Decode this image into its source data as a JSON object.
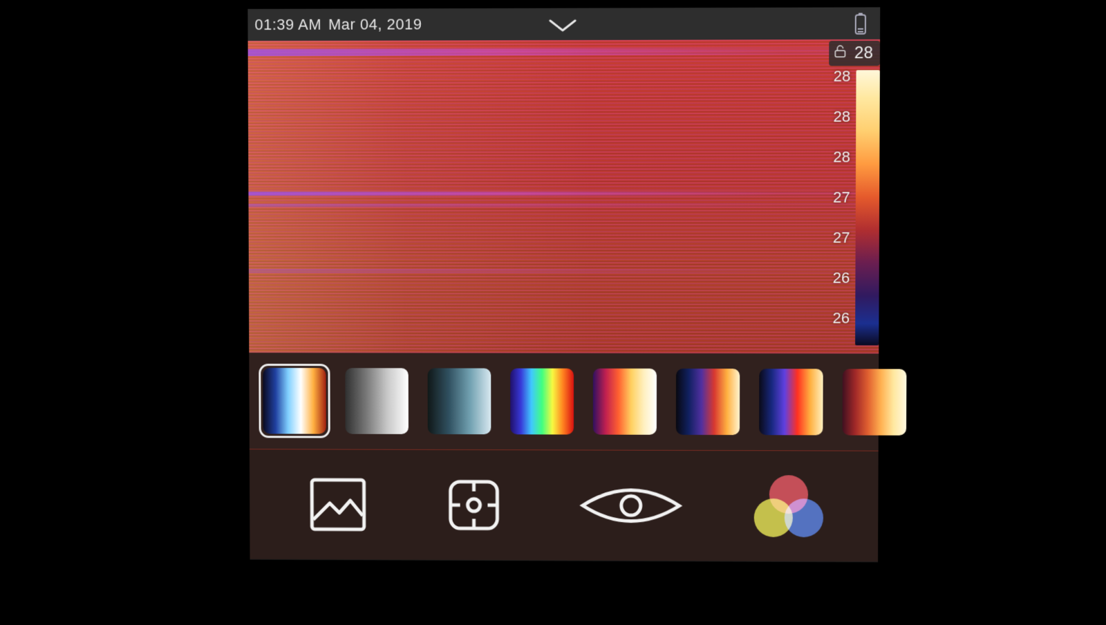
{
  "status_bar": {
    "time": "01:39 AM",
    "date": "Mar 04, 2019"
  },
  "temperature": {
    "current_label": "28",
    "scale_labels": [
      "28",
      "28",
      "28",
      "27",
      "27",
      "26",
      "26"
    ]
  },
  "palettes": [
    {
      "name": "ironbow-cool-hot",
      "selected": true
    },
    {
      "name": "grayscale",
      "selected": false
    },
    {
      "name": "blue-white",
      "selected": false
    },
    {
      "name": "rainbow",
      "selected": false
    },
    {
      "name": "plasma-light",
      "selected": false
    },
    {
      "name": "black-hot-inferno",
      "selected": false
    },
    {
      "name": "blue-red-amber",
      "selected": false
    },
    {
      "name": "amber-hot",
      "selected": false
    }
  ],
  "nav": {
    "gallery": "gallery",
    "focus": "focus",
    "view": "view-mode",
    "color": "color-palette"
  }
}
